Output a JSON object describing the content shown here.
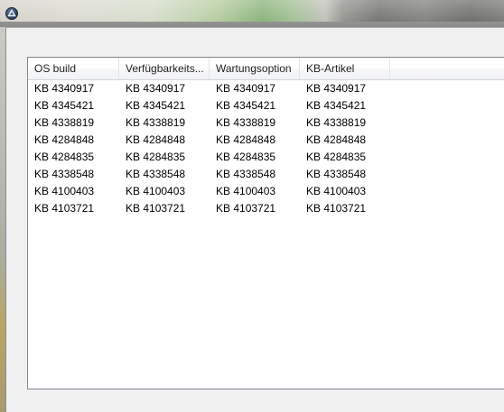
{
  "window": {
    "title": "",
    "icon": "app-logo-icon"
  },
  "table": {
    "columns": [
      {
        "label": "OS build"
      },
      {
        "label": "Verfügbarkeits..."
      },
      {
        "label": "Wartungsoption"
      },
      {
        "label": "KB-Artikel"
      }
    ],
    "rows": [
      [
        "KB 4340917",
        "KB 4340917",
        "KB 4340917",
        "KB 4340917"
      ],
      [
        "KB 4345421",
        "KB 4345421",
        "KB 4345421",
        "KB 4345421"
      ],
      [
        "KB 4338819",
        "KB 4338819",
        "KB 4338819",
        "KB 4338819"
      ],
      [
        "KB 4284848",
        "KB 4284848",
        "KB 4284848",
        "KB 4284848"
      ],
      [
        "KB 4284835",
        "KB 4284835",
        "KB 4284835",
        "KB 4284835"
      ],
      [
        "KB 4338548",
        "KB 4338548",
        "KB 4338548",
        "KB 4338548"
      ],
      [
        "KB 4100403",
        "KB 4100403",
        "KB 4100403",
        "KB 4100403"
      ],
      [
        "KB 4103721",
        "KB 4103721",
        "KB 4103721",
        "KB 4103721"
      ]
    ]
  }
}
